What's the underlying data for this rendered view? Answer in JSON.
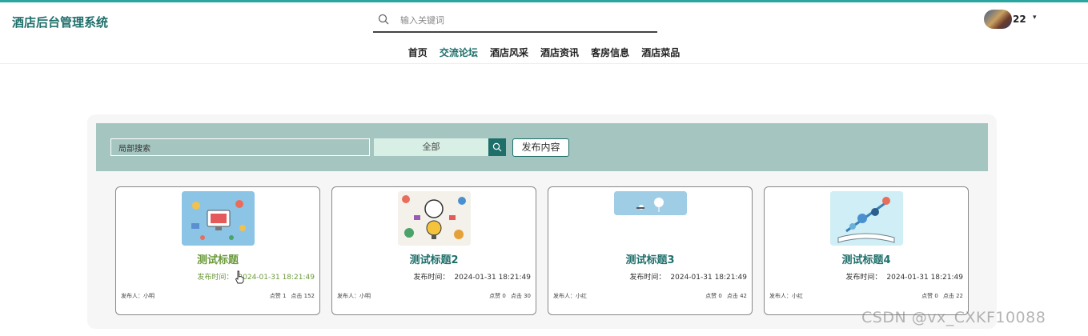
{
  "header": {
    "brand": "酒店后台管理系统",
    "search_placeholder": "输入关键词",
    "username": "22",
    "caret": "▾"
  },
  "nav": {
    "items": [
      "首页",
      "交流论坛",
      "酒店风采",
      "酒店资讯",
      "客房信息",
      "酒店菜品"
    ],
    "active": "交流论坛"
  },
  "filter": {
    "local_search_value": "局部搜索",
    "category_selected": "全部",
    "publish_label": "发布内容"
  },
  "cards": [
    {
      "title": "测试标题",
      "time_label": "发布时间：",
      "time": "2024-01-31 18:21:49",
      "author": "发布人：小明",
      "likes": "点赞 1",
      "clicks": "点击 152"
    },
    {
      "title": "测试标题2",
      "time_label": "发布时间：",
      "time": "2024-01-31 18:21:49",
      "author": "发布人：小明",
      "likes": "点赞 0",
      "clicks": "点击 30"
    },
    {
      "title": "测试标题3",
      "time_label": "发布时间：",
      "time": "2024-01-31 18:21:49",
      "author": "发布人：小红",
      "likes": "点赞 0",
      "clicks": "点击 42"
    },
    {
      "title": "测试标题4",
      "time_label": "发布时间：",
      "time": "2024-01-31 18:21:49",
      "author": "发布人：小红",
      "likes": "点赞 0",
      "clicks": "点击 22"
    }
  ],
  "watermark": "CSDN @vx_CXKF10088",
  "colors": {
    "accent": "#1f6f6b",
    "filter_bar": "#a5c6c0",
    "hover": "#6a9a3a"
  }
}
